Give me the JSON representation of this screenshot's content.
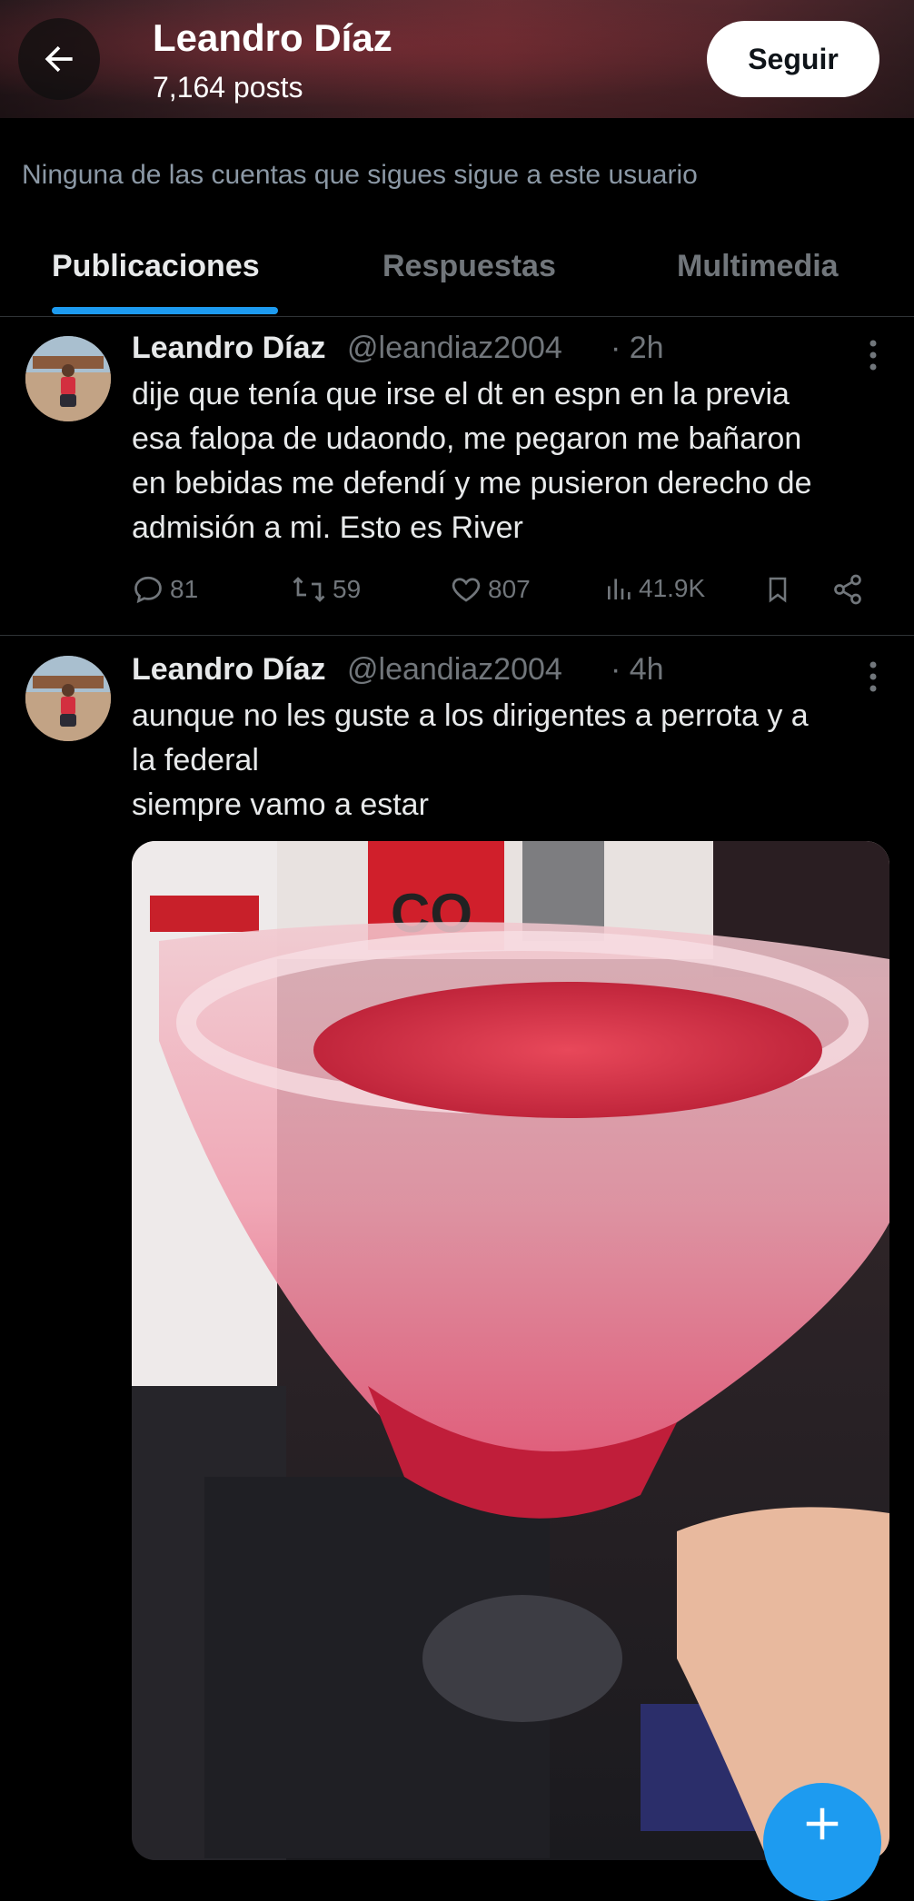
{
  "header": {
    "name": "Leandro Díaz",
    "posts": "7,164 posts",
    "follow_label": "Seguir"
  },
  "follow_context": "Ninguna de las cuentas que sigues sigue a este usuario",
  "tabs": [
    {
      "label": "Publicaciones",
      "active": true
    },
    {
      "label": "Respuestas",
      "active": false
    },
    {
      "label": "Multimedia",
      "active": false
    }
  ],
  "tweets": [
    {
      "name": "Leandro Díaz",
      "handle": "@leandiaz2004",
      "time": "· 2h",
      "lines": [
        "dije que tenía que irse el dt en espn en la previa",
        "esa falopa de udaondo, me pegaron me bañaron",
        "en bebidas me defendí y me pusieron derecho de",
        "admisión a mi. Esto es River"
      ],
      "replies": "81",
      "reposts": "59",
      "likes": "807",
      "views": "41.9K"
    },
    {
      "name": "Leandro Díaz",
      "handle": "@leandiaz2004",
      "time": "· 4h",
      "lines": [
        "aunque no les guste a los dirigentes a perrota y a",
        "la federal",
        "siempre vamo a estar"
      ]
    }
  ],
  "icons": {
    "back": "arrow-left-icon",
    "more": "more-vertical-icon",
    "reply": "comment-icon",
    "repost": "repost-icon",
    "like": "heart-icon",
    "views": "bar-chart-icon",
    "bookmark": "bookmark-icon",
    "share": "share-icon",
    "compose": "plus-icon"
  },
  "colors": {
    "accent": "#1d9bf0",
    "text": "#e7e9ea",
    "muted": "#71767b",
    "background": "#000000"
  }
}
